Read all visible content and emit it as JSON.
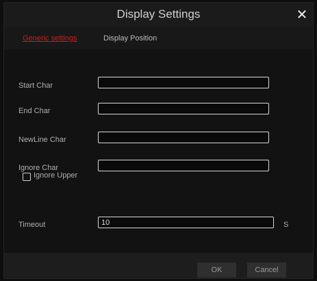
{
  "dialog": {
    "title": "Display Settings",
    "close_icon": "close-icon"
  },
  "tabs": [
    {
      "label": "Generic settings",
      "active": true
    },
    {
      "label": "Display Position",
      "active": false
    }
  ],
  "fields": {
    "start_char": {
      "label": "Start Char",
      "value": ""
    },
    "end_char": {
      "label": "End Char",
      "value": ""
    },
    "newline_char": {
      "label": "NewLine Char",
      "value": ""
    },
    "ignore_char": {
      "label": "Ignore Char",
      "value": ""
    },
    "ignore_upper": {
      "label": "Ignore Upper",
      "checked": false
    },
    "timeout": {
      "label": "Timeout",
      "value": "10",
      "unit": "S"
    }
  },
  "buttons": {
    "ok": "OK",
    "cancel": "Cancel"
  },
  "colors": {
    "active_tab": "#d11b1b",
    "background": "#121212"
  }
}
